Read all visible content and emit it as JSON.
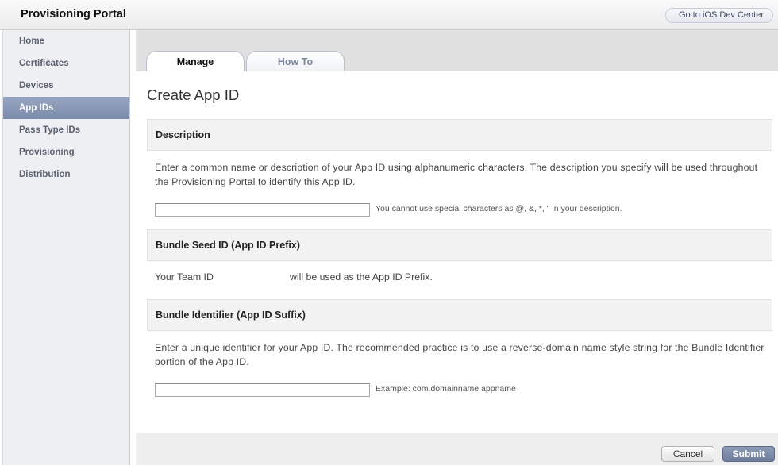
{
  "header": {
    "title": "Provisioning Portal",
    "dev_center_label": "Go to iOS Dev Center"
  },
  "sidebar": {
    "items": [
      {
        "label": "Home",
        "active": false
      },
      {
        "label": "Certificates",
        "active": false
      },
      {
        "label": "Devices",
        "active": false
      },
      {
        "label": "App IDs",
        "active": true
      },
      {
        "label": "Pass Type IDs",
        "active": false
      },
      {
        "label": "Provisioning",
        "active": false
      },
      {
        "label": "Distribution",
        "active": false
      }
    ]
  },
  "tabs": {
    "manage": "Manage",
    "how_to": "How To",
    "active": "Manage"
  },
  "main": {
    "title": "Create App ID",
    "description": {
      "heading": "Description",
      "text": "Enter a common name or description of your App ID using alphanumeric characters. The description you specify will be used throughout the Provisioning Portal to identify this App ID.",
      "input_value": "",
      "hint": "You cannot use special characters as @, &, *, \" in your description."
    },
    "bundle_seed": {
      "heading": "Bundle Seed ID (App ID Prefix)",
      "team_label": "Your Team ID",
      "suffix_text": "will be used as the App ID Prefix."
    },
    "bundle_identifier": {
      "heading": "Bundle Identifier (App ID Suffix)",
      "text": "Enter a unique identifier for your App ID. The recommended practice is to use a reverse-domain name style string for the Bundle Identifier portion of the App ID.",
      "input_value": "",
      "hint": "Example: com.domainname.appname"
    }
  },
  "footer": {
    "cancel_label": "Cancel",
    "submit_label": "Submit"
  },
  "colors": {
    "sidebar_active": "#8594b3",
    "submit_button": "#7a89a7",
    "section_header_bg": "#f2f2f2"
  }
}
